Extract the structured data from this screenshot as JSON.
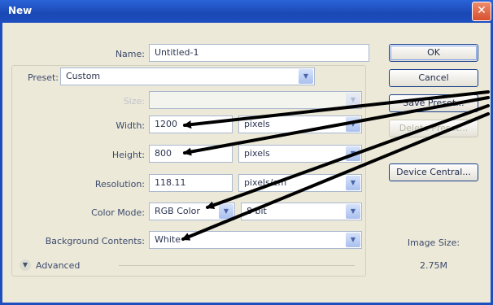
{
  "window": {
    "title": "New",
    "close_glyph": "✕"
  },
  "form": {
    "name_label": "Name:",
    "name_value": "Untitled-1",
    "preset_label": "Preset:",
    "preset_value": "Custom",
    "size_label": "Size:",
    "width_label": "Width:",
    "width_value": "1200",
    "width_unit": "pixels",
    "height_label": "Height:",
    "height_value": "800",
    "height_unit": "pixels",
    "resolution_label": "Resolution:",
    "resolution_value": "118.11",
    "resolution_unit": "pixels/cm",
    "color_mode_label": "Color Mode:",
    "color_mode_value": "RGB Color",
    "bit_depth_value": "8 bit",
    "background_label": "Background Contents:",
    "background_value": "White",
    "advanced_label": "Advanced"
  },
  "buttons": {
    "ok": "OK",
    "cancel": "Cancel",
    "save_preset": "Save Preset...",
    "delete_preset": "Delete Preset...",
    "device_central": "Device Central..."
  },
  "info": {
    "image_size_label": "Image Size:",
    "image_size_value": "2.75M"
  },
  "icons": {
    "dropdown": "chevron-down-icon",
    "close": "close-icon",
    "advanced_toggle": "expand-icon"
  },
  "colors": {
    "titlebar": "#1e4fc0",
    "dialog_bg": "#ece9d8",
    "annotation_arrows": "#000000"
  }
}
